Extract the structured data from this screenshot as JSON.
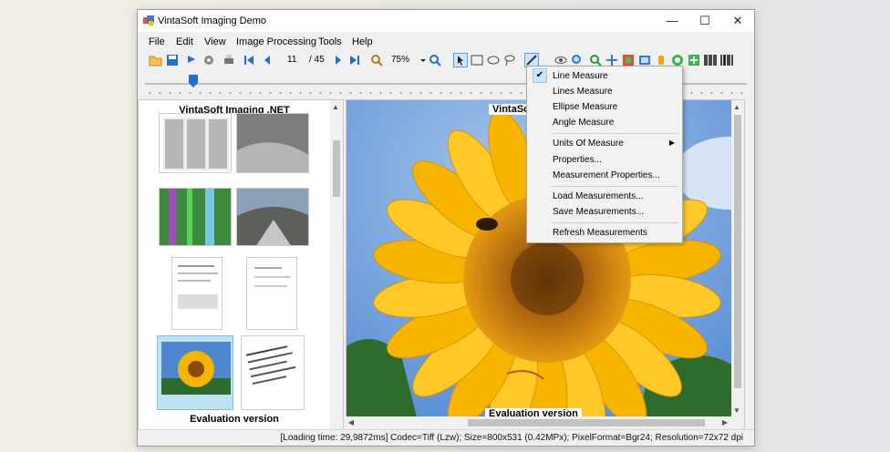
{
  "window": {
    "title": "VintaSoft Imaging Demo",
    "controls": {
      "minimize": "—",
      "maximize": "☐",
      "close": "✕"
    }
  },
  "menubar": {
    "items": [
      "File",
      "Edit",
      "View",
      "Image Processing",
      "Tools",
      "Help"
    ]
  },
  "toolbar": {
    "page_current": "11",
    "page_total": "/ 45",
    "zoom": "75%"
  },
  "thumbnails": {
    "title": "VintaSoft Imaging .NET",
    "footer": "Evaluation version"
  },
  "viewer": {
    "top_label": "VintaSoft",
    "bottom_label": "Evaluation version"
  },
  "measure_menu": {
    "items": [
      {
        "label": "Line Measure",
        "checked": true
      },
      {
        "label": "Lines Measure"
      },
      {
        "label": "Ellipse Measure"
      },
      {
        "label": "Angle Measure"
      },
      {
        "label": "Units Of Measure",
        "submenu": true
      },
      {
        "label": "Properties..."
      },
      {
        "label": "Measurement Properties..."
      },
      {
        "label": "Load Measurements..."
      },
      {
        "label": "Save Measurements..."
      },
      {
        "label": "Refresh Measurements"
      }
    ]
  },
  "statusbar": {
    "text": "[Loading time: 29,9872ms]  Codec=Tiff (Lzw); Size=800x531 (0.42MPx); PixelFormat=Bgr24; Resolution=72x72 dpi"
  },
  "colors": {
    "accent": "#1f6fd1",
    "sky": "#6f9bd6",
    "petal": "#f5b400",
    "center": "#b8700e"
  }
}
